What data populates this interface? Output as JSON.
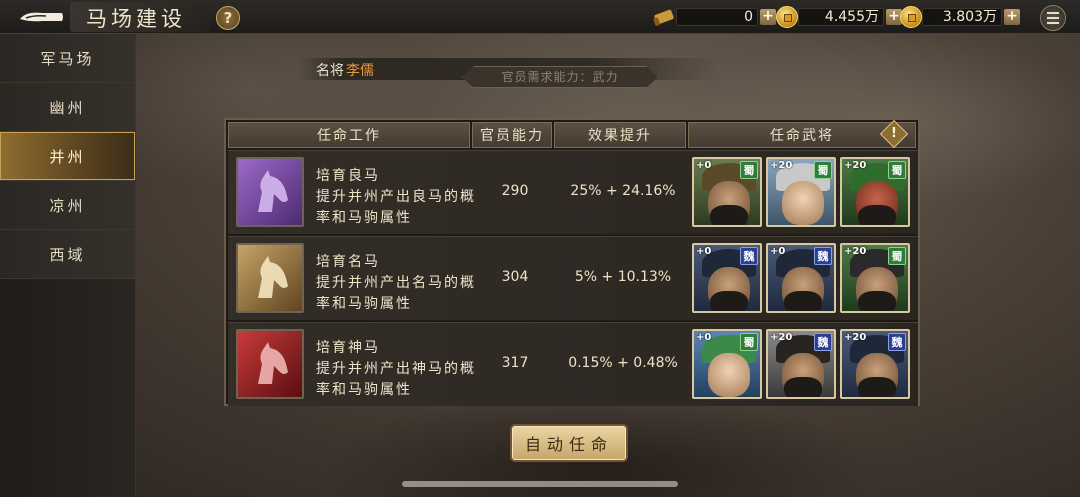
{
  "header": {
    "title": "马场建设",
    "help_label": "?",
    "resources": [
      {
        "icon": "scroll-icon",
        "value": "0"
      },
      {
        "icon": "gold-coin-icon",
        "value": "4.455万"
      },
      {
        "icon": "copper-coin-icon",
        "value": "3.803万"
      }
    ],
    "plus_label": "+"
  },
  "sidebar": {
    "items": [
      {
        "label": "军马场",
        "active": false
      },
      {
        "label": "幽州",
        "active": false
      },
      {
        "label": "并州",
        "active": true
      },
      {
        "label": "凉州",
        "active": false
      },
      {
        "label": "西域",
        "active": false
      }
    ]
  },
  "general": {
    "label": "名将",
    "name": "李儒",
    "requirement": "官员需求能力：武力"
  },
  "table": {
    "headers": [
      "任命工作",
      "官员能力",
      "效果提升",
      "任命武将"
    ],
    "rows": [
      {
        "title": "培育良马",
        "desc": "提升并州产出良马的概率和马驹属性",
        "ability": "290",
        "effect": "25% + 24.16%",
        "icon_color": "#7b4aa6",
        "generals": [
          {
            "plus": "+0",
            "kingdom": "蜀"
          },
          {
            "plus": "+20",
            "kingdom": "蜀"
          },
          {
            "plus": "+20",
            "kingdom": "蜀"
          }
        ]
      },
      {
        "title": "培育名马",
        "desc": "提升并州产出名马的概率和马驹属性",
        "ability": "304",
        "effect": "5% + 10.13%",
        "icon_color": "#b48a4a",
        "generals": [
          {
            "plus": "+0",
            "kingdom": "魏"
          },
          {
            "plus": "+0",
            "kingdom": "魏"
          },
          {
            "plus": "+20",
            "kingdom": "蜀"
          }
        ]
      },
      {
        "title": "培育神马",
        "desc": "提升并州产出神马的概率和马驹属性",
        "ability": "317",
        "effect": "0.15% + 0.48%",
        "icon_color": "#a3262a",
        "generals": [
          {
            "plus": "+0",
            "kingdom": "蜀"
          },
          {
            "plus": "+20",
            "kingdom": "魏"
          },
          {
            "plus": "+20",
            "kingdom": "魏"
          }
        ]
      }
    ]
  },
  "auto_button_label": "自动任命"
}
